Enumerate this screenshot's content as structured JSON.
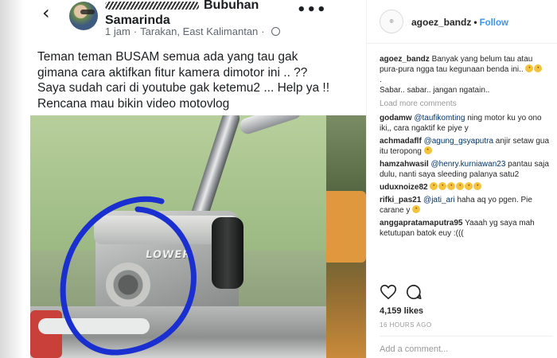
{
  "facebook_post": {
    "back_icon": "chevron-left-icon",
    "author_suffix": "Bubuhan",
    "author_line2": "Samarinda",
    "time": "1 jam",
    "location": "Tarakan, East Kalimantan",
    "separator": "·",
    "more_icon": "more-dots-icon",
    "more_glyph": "•••",
    "back_glyph": "‹",
    "text_lines": [
      "Teman teman BUSAM semua ada yang tau gak",
      "gimana cara aktifkan fitur kamera dimotor ini .. ??",
      "Saya sudah cari di youtube gak ketemu2 ... Help ya !!",
      "Rencana mau bikin video motovlog"
    ],
    "photo_label": "LOWER",
    "annotation_color": "#1a2fd0"
  },
  "instagram": {
    "username": "agoez_bandz",
    "follow_label": "Follow",
    "dot": "•",
    "caption": {
      "user": "agoez_bandz",
      "text": "Banyak yang belum tau atau pura-pura ngga tau kegunaan benda ini..",
      "line2": ".",
      "line3": "Sabar.. sabar.. jangan ngatain.."
    },
    "load_more": "Load more comments",
    "comments": [
      {
        "user": "godamw",
        "mention": "@taufikomting",
        "text": "ning motor ku yo ono iki,, cara ngaktif ke piye y"
      },
      {
        "user": "achmadaflf",
        "mention": "@agung_gsyaputra",
        "text": "anjir setaw gua itu teropong"
      },
      {
        "user": "hamzahwasil",
        "mention": "@henry.kurniawan23",
        "text": "pantau saja dulu, nanti saya sleeding palanya satu2"
      },
      {
        "user": "uduxnoize82",
        "mention": "",
        "text": ""
      },
      {
        "user": "rifki_pas21",
        "mention": "@jati_ari",
        "text": "haha aq yo pgen. Pie carane y"
      },
      {
        "user": "anggapratamaputra95",
        "mention": "",
        "text": "Yaaah yg saya mah ketutupan batok euy :((("
      }
    ],
    "likes": "4,159 likes",
    "time": "16 HOURS AGO",
    "add_comment_placeholder": "Add a comment...",
    "colors": {
      "link": "#3897f0",
      "mention": "#003569",
      "muted": "#999999"
    }
  }
}
